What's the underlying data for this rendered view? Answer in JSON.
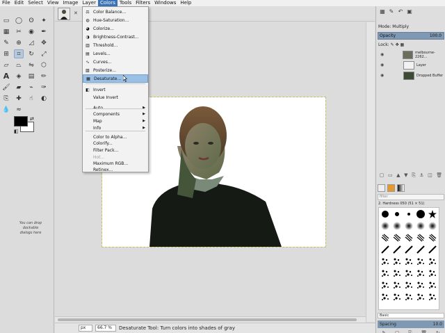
{
  "menubar": [
    "File",
    "Edit",
    "Select",
    "View",
    "Image",
    "Layer",
    "Colors",
    "Tools",
    "Filters",
    "Windows",
    "Help"
  ],
  "active_menu": "Colors",
  "colors_menu": {
    "items": [
      {
        "label": "Color Balance...",
        "icon": "color-balance-icon"
      },
      {
        "label": "Hue-Saturation...",
        "icon": "hue-saturation-icon"
      },
      {
        "label": "Colorize...",
        "icon": "colorize-icon"
      },
      {
        "label": "Brightness-Contrast...",
        "icon": "brightness-contrast-icon"
      },
      {
        "label": "Threshold...",
        "icon": "threshold-icon"
      },
      {
        "label": "Levels...",
        "icon": "levels-icon"
      },
      {
        "label": "Curves...",
        "icon": "curves-icon"
      },
      {
        "label": "Posterize...",
        "icon": "posterize-icon"
      },
      {
        "label": "Desaturate...",
        "icon": "desaturate-icon",
        "highlighted": true
      },
      {
        "label": "Invert",
        "icon": "invert-icon"
      },
      {
        "label": "Value Invert",
        "icon": ""
      },
      {
        "label": "Auto",
        "submenu": true
      },
      {
        "label": "Components",
        "submenu": true
      },
      {
        "label": "Map",
        "submenu": true
      },
      {
        "label": "Info",
        "submenu": true
      },
      {
        "label": "Color to Alpha..."
      },
      {
        "label": "Colorify..."
      },
      {
        "label": "Filter Pack..."
      },
      {
        "label": "Hot...",
        "disabled": true
      },
      {
        "label": "Maximum RGB..."
      },
      {
        "label": "Retinex..."
      }
    ]
  },
  "toolbox": {
    "drop_hint": "You can drop dockable dialogs here",
    "foreground_color": "#000000",
    "background_color": "#ffffff"
  },
  "statusbar": {
    "unit": "px",
    "zoom": "66.7 %",
    "message": "Desaturate Tool: Turn colors into shades of gray"
  },
  "layers_panel": {
    "mode_label": "Mode:",
    "mode_value": "Multiply",
    "opacity_label": "Opacity",
    "opacity_value": "100.0",
    "lock_label": "Lock:",
    "layers": [
      {
        "name": "melbourne-2262...",
        "visible": true
      },
      {
        "name": "Layer",
        "visible": true
      },
      {
        "name": "Dropped Buffer",
        "visible": true
      }
    ]
  },
  "brushes_panel": {
    "filter_placeholder": "filter",
    "brush_name": "2. Hardness 050 (51 × 51)",
    "preset": "Basic",
    "spacing_label": "Spacing",
    "spacing_value": "10.0"
  },
  "colors": {
    "accent": "#3b73b9",
    "menu_highlight": "#9ac0e6",
    "slider_fill": "#7f98b4"
  }
}
